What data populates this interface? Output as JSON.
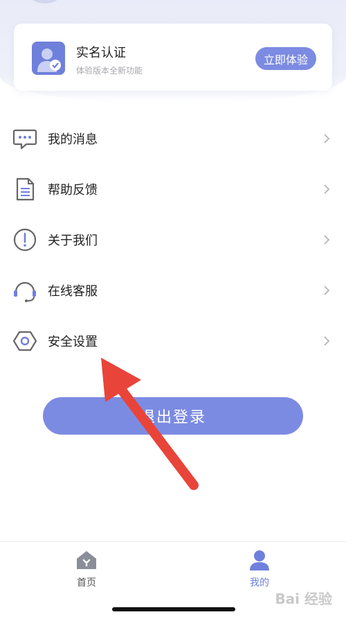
{
  "verification_card": {
    "title": "实名认证",
    "subtitle": "体验版本全新功能",
    "button_label": "立即体验"
  },
  "menu": {
    "items": [
      {
        "label": "我的消息",
        "icon": "message-icon"
      },
      {
        "label": "帮助反馈",
        "icon": "document-icon"
      },
      {
        "label": "关于我们",
        "icon": "info-icon"
      },
      {
        "label": "在线客服",
        "icon": "headset-icon"
      },
      {
        "label": "安全设置",
        "icon": "hexagon-settings-icon"
      }
    ]
  },
  "logout": {
    "label": "退出登录"
  },
  "tabbar": {
    "home_label": "首页",
    "mine_label": "我的"
  },
  "watermark": {
    "text": "Bai 经验"
  },
  "colors": {
    "accent": "#7c8be2",
    "arrow": "#e8443a"
  }
}
